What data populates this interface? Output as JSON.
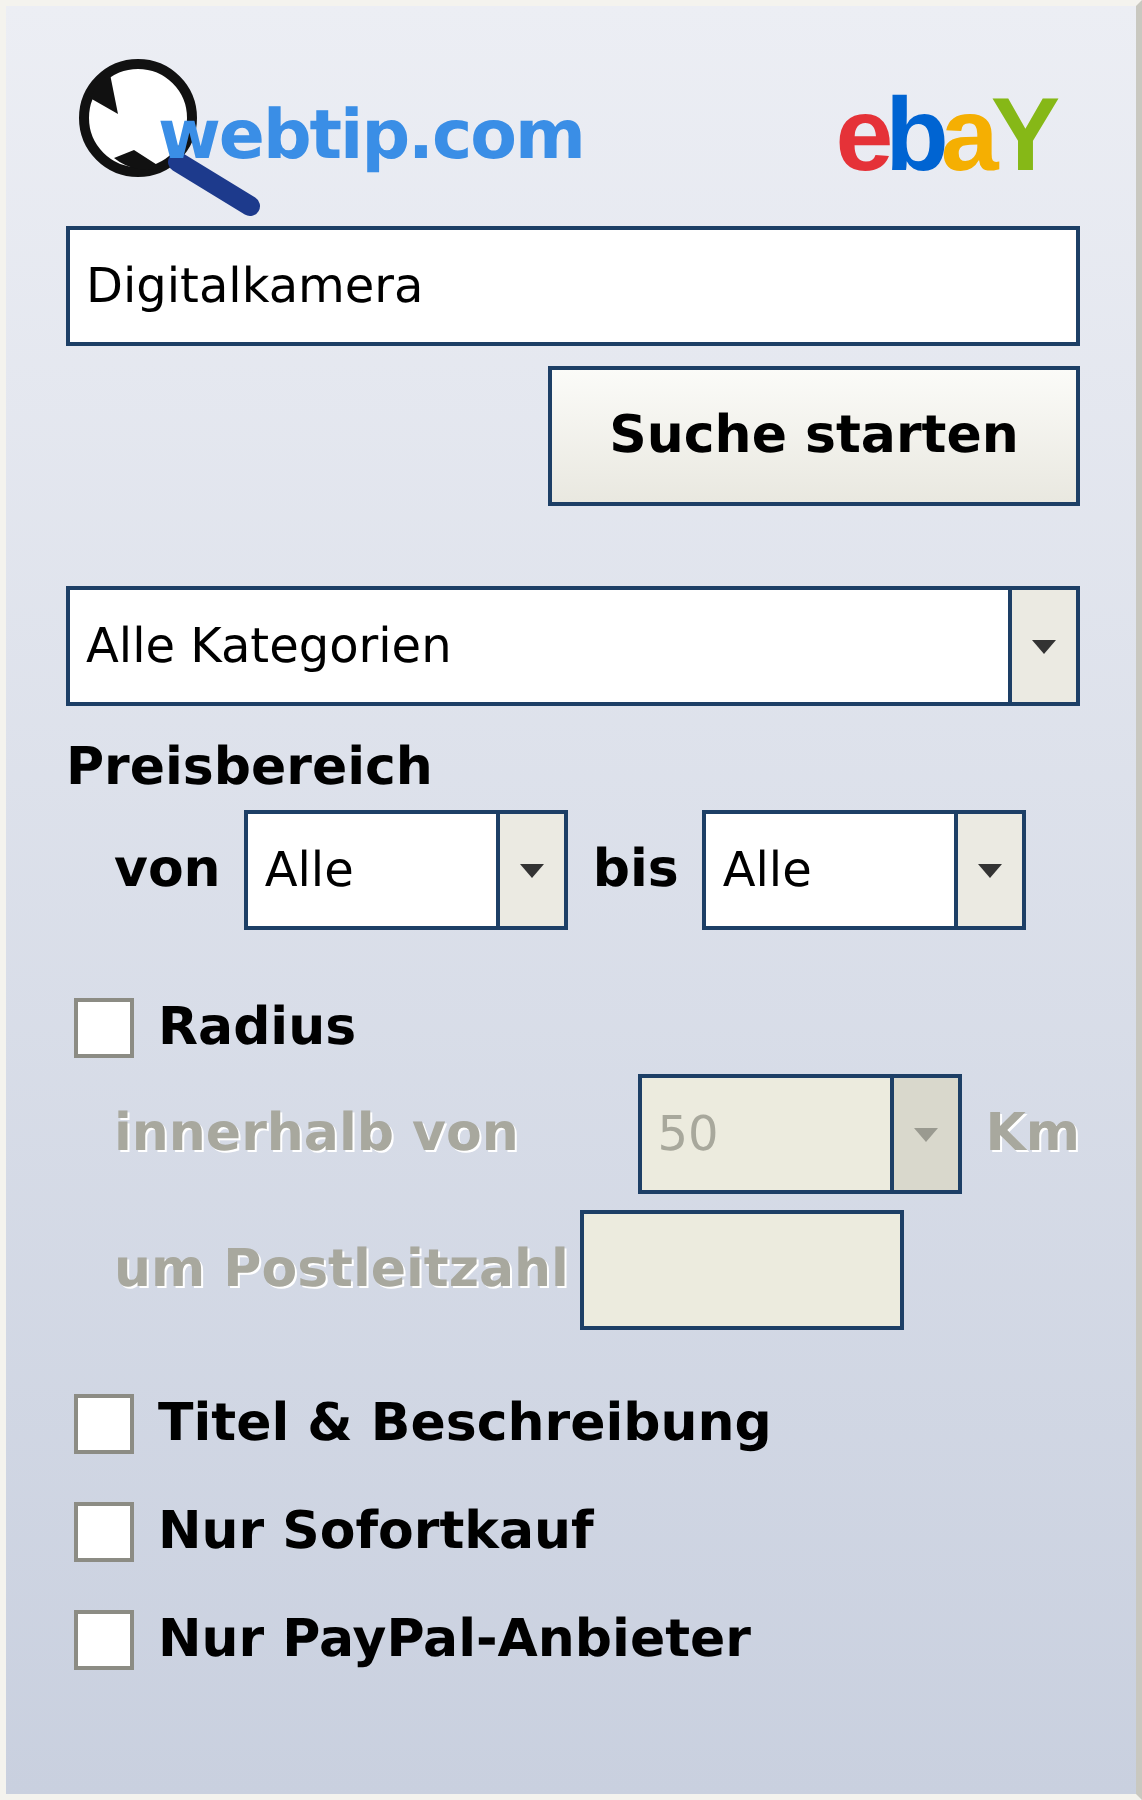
{
  "logos": {
    "webtip": "webtip.com",
    "ebay": "ebaY"
  },
  "search": {
    "value": "Digitalkamera"
  },
  "search_button": "Suche starten",
  "category": {
    "value": "Alle Kategorien"
  },
  "price": {
    "label": "Preisbereich",
    "from_label": "von",
    "from": "Alle",
    "to_label": "bis",
    "to": "Alle"
  },
  "radius": {
    "label": "Radius",
    "checked": false,
    "disabled": true,
    "within_label": "innerhalb von",
    "distance": "50",
    "unit": "Km",
    "zip_label": "um Postleitzahl"
  },
  "options": [
    {
      "label": "Titel & Beschreibung",
      "checked": false
    },
    {
      "label": "Nur Sofortkauf",
      "checked": false
    },
    {
      "label": "Nur PayPal-Anbieter",
      "checked": false
    }
  ]
}
